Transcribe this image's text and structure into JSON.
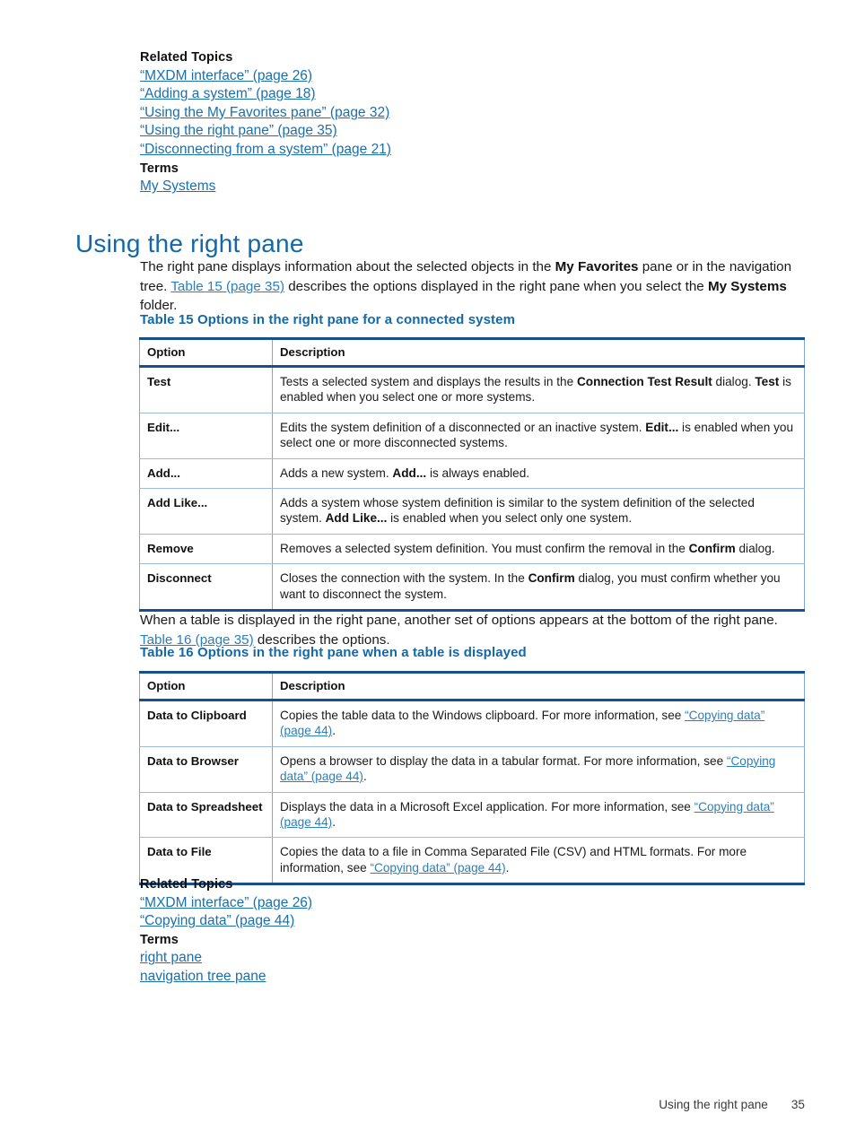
{
  "top_related": {
    "heading": "Related Topics",
    "links": [
      "“MXDM interface” (page 26)",
      "“Adding a system” (page 18)",
      "“Using the My Favorites pane” (page 32)",
      "“Using the right pane” (page 35)",
      "“Disconnecting from a system” (page 21)"
    ],
    "terms_heading": "Terms",
    "terms": [
      "My Systems"
    ]
  },
  "section": {
    "title": "Using the right pane",
    "intro_part1": "The right pane displays information about the selected objects in the ",
    "intro_bold1": "My Favorites",
    "intro_part2": " pane or in the navigation tree. ",
    "intro_link": "Table 15 (page 35)",
    "intro_part3": " describes the options displayed in the right pane when you select the ",
    "intro_bold2": "My Systems",
    "intro_part4": " folder."
  },
  "table15": {
    "caption": "Table 15 Options in the right pane for a connected system",
    "headers": [
      "Option",
      "Description"
    ],
    "rows": [
      {
        "option": "Test",
        "desc_parts": [
          {
            "t": "Tests a selected system and displays the results in the ",
            "b": false
          },
          {
            "t": "Connection Test Result",
            "b": true
          },
          {
            "t": " dialog. ",
            "b": false
          },
          {
            "t": "Test",
            "b": true
          },
          {
            "t": " is enabled when you select one or more systems.",
            "b": false
          }
        ]
      },
      {
        "option": "Edit...",
        "desc_parts": [
          {
            "t": "Edits the system definition of a disconnected or an inactive system. ",
            "b": false
          },
          {
            "t": "Edit...",
            "b": true
          },
          {
            "t": " is enabled when you select one or more disconnected systems.",
            "b": false
          }
        ]
      },
      {
        "option": "Add...",
        "desc_parts": [
          {
            "t": "Adds a new system. ",
            "b": false
          },
          {
            "t": "Add...",
            "b": true
          },
          {
            "t": " is always enabled.",
            "b": false
          }
        ]
      },
      {
        "option": "Add Like...",
        "desc_parts": [
          {
            "t": "Adds a system whose system definition is similar to the system definition of the selected system. ",
            "b": false
          },
          {
            "t": "Add Like...",
            "b": true
          },
          {
            "t": " is enabled when you select only one system.",
            "b": false
          }
        ]
      },
      {
        "option": "Remove",
        "desc_parts": [
          {
            "t": "Removes a selected system definition. You must confirm the removal in the ",
            "b": false
          },
          {
            "t": "Confirm",
            "b": true
          },
          {
            "t": " dialog.",
            "b": false
          }
        ]
      },
      {
        "option": "Disconnect",
        "desc_parts": [
          {
            "t": "Closes the connection with the system. In the ",
            "b": false
          },
          {
            "t": "Confirm",
            "b": true
          },
          {
            "t": " dialog, you must confirm whether you want to disconnect the system.",
            "b": false
          }
        ]
      }
    ]
  },
  "mid_para": {
    "part1": "When a table is displayed in the right pane, another set of options appears at the bottom of the right pane. ",
    "link": "Table 16 (page 35)",
    "part2": " describes the options."
  },
  "table16": {
    "caption": "Table 16 Options in the right pane when a table is displayed",
    "headers": [
      "Option",
      "Description"
    ],
    "rows": [
      {
        "option": "Data to Clipboard",
        "desc_parts": [
          {
            "t": "Copies the table data to the Windows clipboard. For more information, see ",
            "b": false,
            "l": false
          },
          {
            "t": "“Copying data” (page 44)",
            "b": false,
            "l": true
          },
          {
            "t": ".",
            "b": false,
            "l": false
          }
        ]
      },
      {
        "option": "Data to Browser",
        "desc_parts": [
          {
            "t": "Opens a browser to display the data in a tabular format. For more information, see ",
            "b": false,
            "l": false
          },
          {
            "t": "“Copying data” (page 44)",
            "b": false,
            "l": true
          },
          {
            "t": ".",
            "b": false,
            "l": false
          }
        ]
      },
      {
        "option": "Data to Spreadsheet",
        "desc_parts": [
          {
            "t": "Displays the data in a Microsoft Excel application. For more information, see ",
            "b": false,
            "l": false
          },
          {
            "t": "“Copying data” (page 44)",
            "b": false,
            "l": true
          },
          {
            "t": ".",
            "b": false,
            "l": false
          }
        ]
      },
      {
        "option": "Data to File",
        "desc_parts": [
          {
            "t": "Copies the data to a file in Comma Separated File (CSV) and HTML formats. For more information, see ",
            "b": false,
            "l": false
          },
          {
            "t": "“Copying data” (page 44)",
            "b": false,
            "l": true
          },
          {
            "t": ".",
            "b": false,
            "l": false
          }
        ]
      }
    ]
  },
  "bottom_related": {
    "heading": "Related Topics",
    "links": [
      "“MXDM interface” (page 26)",
      "“Copying data” (page 44)"
    ],
    "terms_heading": "Terms",
    "terms": [
      "right pane",
      "navigation tree pane"
    ]
  },
  "footer": {
    "section_name": "Using the right pane",
    "page_number": "35"
  },
  "colors": {
    "heading_blue": "#1368a8",
    "link_blue": "#1a6faf",
    "table_border_dark": "#17518c",
    "table_border_light": "#9dbcda"
  }
}
